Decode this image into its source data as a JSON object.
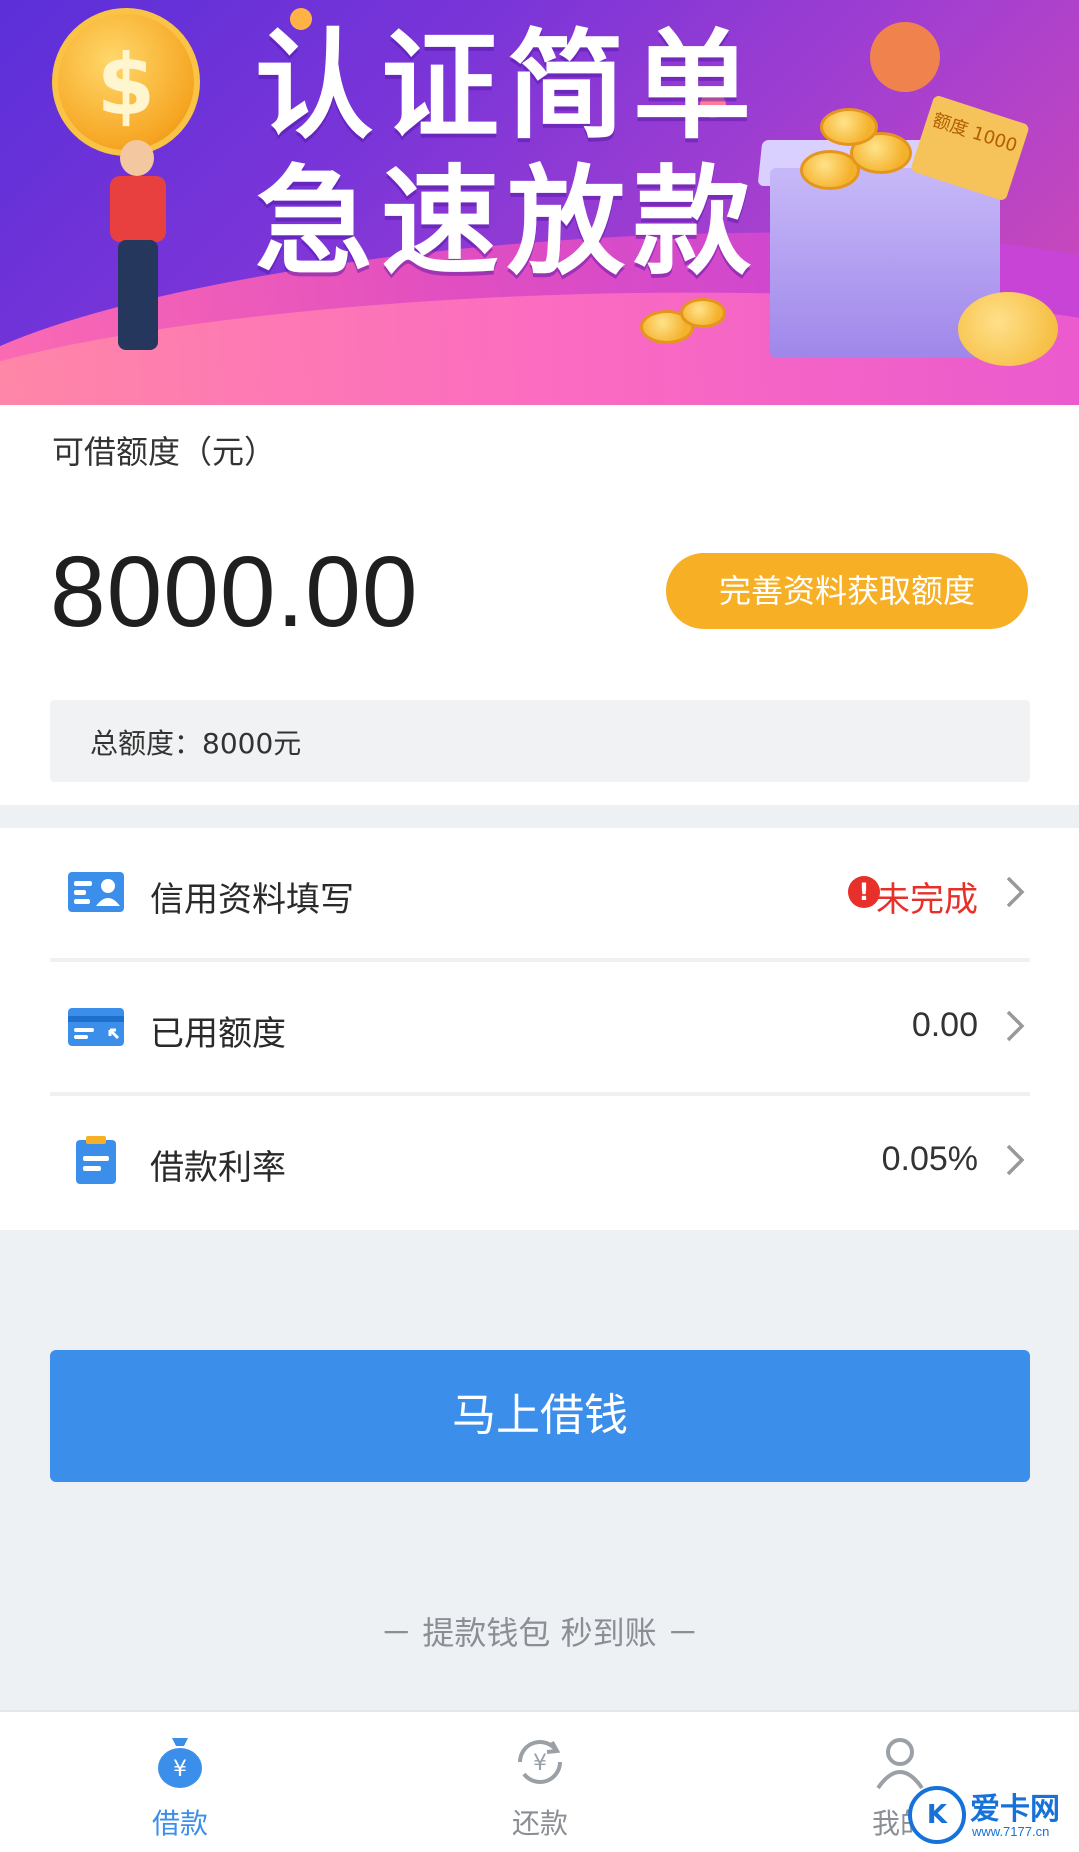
{
  "banner": {
    "line1": "认证简单",
    "line2": "急速放款",
    "coin_symbol": "$",
    "ticket_text": "额度 1000"
  },
  "credit": {
    "label": "可借额度（元）",
    "amount": "8000.00",
    "cta_label": "完善资料获取额度",
    "total_text": "总额度：8000元"
  },
  "list": [
    {
      "label": "信用资料填写",
      "value": "未完成",
      "status": "incomplete",
      "icon": "id-card-icon"
    },
    {
      "label": "已用额度",
      "value": "0.00",
      "icon": "credit-card-icon"
    },
    {
      "label": "借款利率",
      "value": "0.05%",
      "icon": "clipboard-icon"
    }
  ],
  "alert_glyph": "!",
  "borrow_button": "马上借钱",
  "slogan": "－ 提款钱包 秒到账 －",
  "tabs": [
    {
      "label": "借款",
      "icon": "money-bag-icon",
      "active": true
    },
    {
      "label": "还款",
      "icon": "yuan-refresh-icon",
      "active": false
    },
    {
      "label": "我的",
      "icon": "user-icon",
      "active": false
    }
  ],
  "watermark": {
    "name": "爱卡网",
    "url": "www.7177.cn",
    "logo": "K"
  },
  "colors": {
    "primary": "#3c8eeb",
    "accent": "#f7b026",
    "alert": "#e8302a"
  }
}
